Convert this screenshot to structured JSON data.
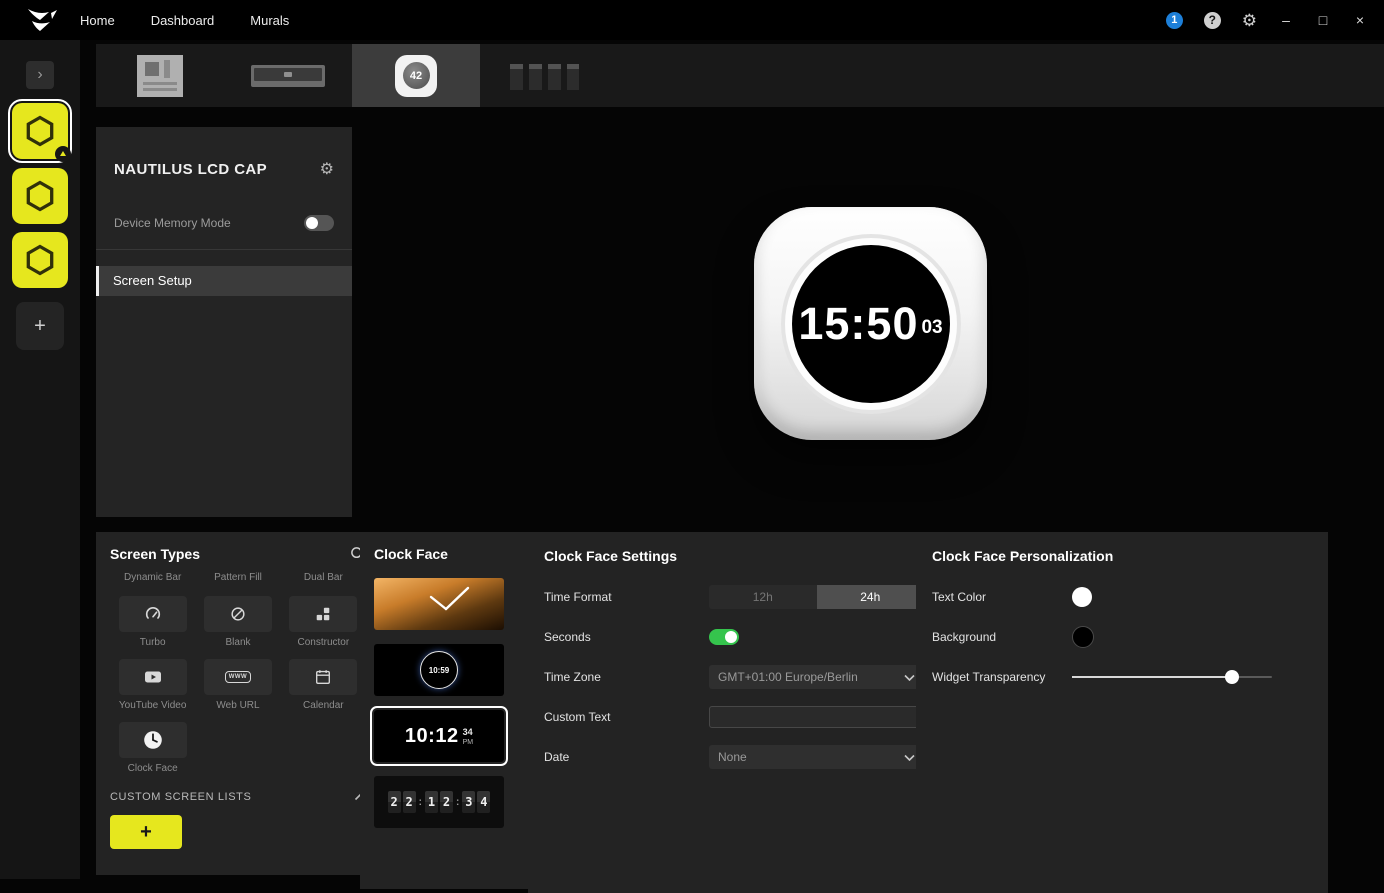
{
  "colors": {
    "accent_yellow": "#e6e71e",
    "toggle_on_green": "#35c44d",
    "notification_blue": "#1d7fd8"
  },
  "icons": {
    "gear": "⚙",
    "help": "?",
    "minimize": "–",
    "maximize": "□",
    "close": "×",
    "expand": "›",
    "plus": "+",
    "www": "WWW"
  },
  "titlebar": {
    "nav": [
      "Home",
      "Dashboard",
      "Murals"
    ],
    "notification_count": "1"
  },
  "tabs": {
    "lcd_badge": "42"
  },
  "device_panel": {
    "title": "NAUTILUS LCD CAP",
    "memory_mode_label": "Device Memory Mode",
    "menu": [
      "Screen Setup"
    ]
  },
  "preview": {
    "time": "15:50",
    "seconds": "03"
  },
  "screen_types": {
    "title": "Screen Types",
    "labels": [
      "Dynamic Bar",
      "Pattern Fill",
      "Dual Bar",
      "Turbo",
      "Blank",
      "Constructor",
      "YouTube Video",
      "Web URL",
      "Calendar",
      "Clock Face"
    ],
    "custom_lists_title": "CUSTOM SCREEN LISTS"
  },
  "clock_faces": {
    "title": "Clock Face",
    "analog_dark_time": "10:59",
    "digital": {
      "time": "10:12",
      "seconds": "34",
      "ampm": "PM"
    },
    "flip_digits": [
      "2",
      "2",
      "1",
      "2",
      "3",
      "4"
    ],
    "flip_separator": ":"
  },
  "settings": {
    "title": "Clock Face Settings",
    "time_format": {
      "label": "Time Format",
      "options": [
        "12h",
        "24h"
      ],
      "selected": "24h"
    },
    "seconds": {
      "label": "Seconds",
      "state": "on"
    },
    "time_zone": {
      "label": "Time Zone",
      "value": "GMT+01:00 Europe/Berlin"
    },
    "custom_text": {
      "label": "Custom Text",
      "value": ""
    },
    "date": {
      "label": "Date",
      "value": "None"
    }
  },
  "personalization": {
    "title": "Clock Face Personalization",
    "text_color": {
      "label": "Text Color",
      "value": "#ffffff"
    },
    "background": {
      "label": "Background",
      "value": "#000000"
    },
    "transparency": {
      "label": "Widget Transparency",
      "percent": 80
    }
  }
}
